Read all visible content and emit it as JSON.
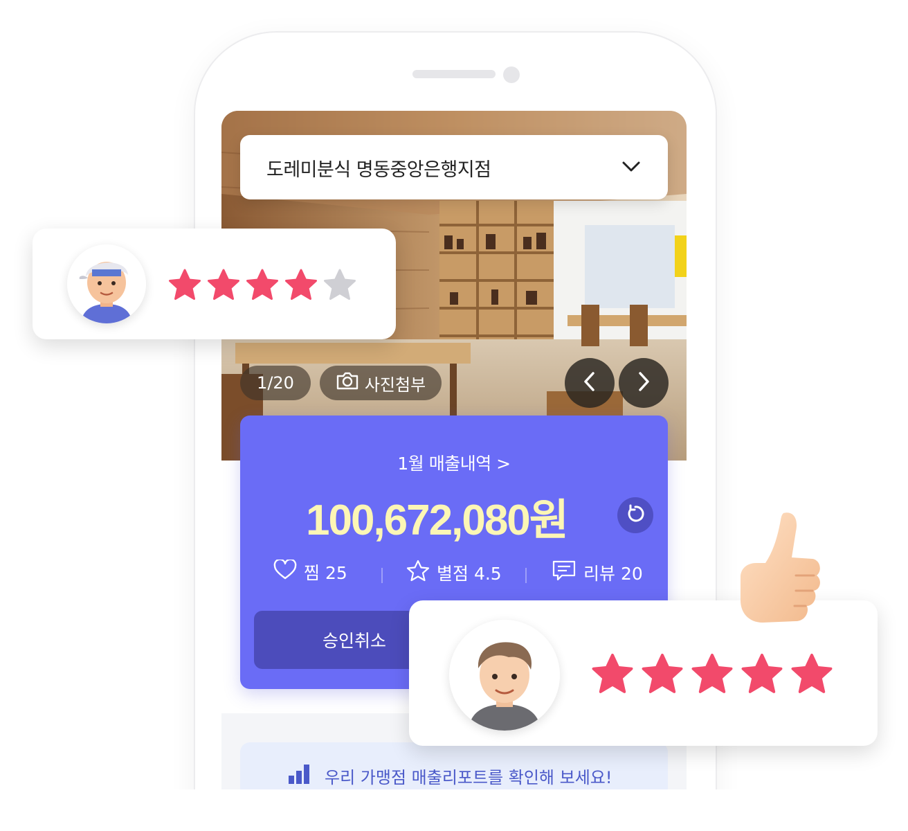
{
  "store": {
    "name": "도레미분식 명동중앙은행지점",
    "dropdown_icon": "chevron-down-icon"
  },
  "photo": {
    "counter": "1/20",
    "attach_label": "사진첨부",
    "prev_icon": "chevron-left-icon",
    "next_icon": "chevron-right-icon"
  },
  "sales": {
    "link_label": "1월 매출내역 >",
    "amount": "100,672,080원",
    "refresh_icon": "refresh-icon",
    "stats": [
      {
        "icon": "heart-icon",
        "label": "찜 25"
      },
      {
        "icon": "star-outline-icon",
        "label": "별점 4.5"
      },
      {
        "icon": "chat-icon",
        "label": "리뷰 20"
      }
    ],
    "cancel_label": "승인취소"
  },
  "report": {
    "icon": "bar-chart-icon",
    "text": "우리 가맹점 매출리포트를 확인해 보세요!"
  },
  "reviews": [
    {
      "avatar": "boy-cap-avatar",
      "rating": 4,
      "max": 5
    },
    {
      "avatar": "man-avatar",
      "rating": 5,
      "max": 5
    }
  ],
  "colors": {
    "accent": "#6a6cf6",
    "amount": "#fcf6b5",
    "star": "#f24a6b",
    "star_empty": "#cfcfd4",
    "report_text": "#4a59c9"
  }
}
